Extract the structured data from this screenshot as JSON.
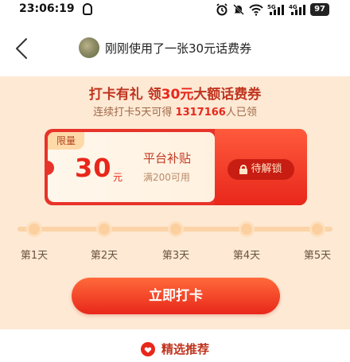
{
  "status_bar": {
    "time": "23:06:19",
    "battery": "97",
    "icons": [
      "alarm-icon",
      "mute-icon",
      "wifi-icon",
      "signal-5g-icon",
      "signal-4g-icon",
      "battery-icon"
    ]
  },
  "header": {
    "title": "刚刚使用了一张30元话费券",
    "back_icon": "chevron-left-icon"
  },
  "promo": {
    "title_prefix": "打卡有礼 领",
    "title_amount": "30元",
    "title_suffix": "大额话费券",
    "subtitle_prefix": "连续打卡5天可得",
    "subtitle_count": "1317166",
    "subtitle_suffix": "人已领"
  },
  "coupon": {
    "tag": "限量",
    "value": "30",
    "unit": "元",
    "name": "平台补贴",
    "condition": "满200可用",
    "action_label": "待解锁"
  },
  "progress": {
    "days": [
      "第1天",
      "第2天",
      "第3天",
      "第4天",
      "第5天"
    ],
    "completed": 0
  },
  "cta": {
    "label": "立即打卡"
  },
  "recommend": {
    "label": "精选推荐"
  },
  "colors": {
    "accent": "#e8271b",
    "promo_background": "#fde9d4"
  }
}
